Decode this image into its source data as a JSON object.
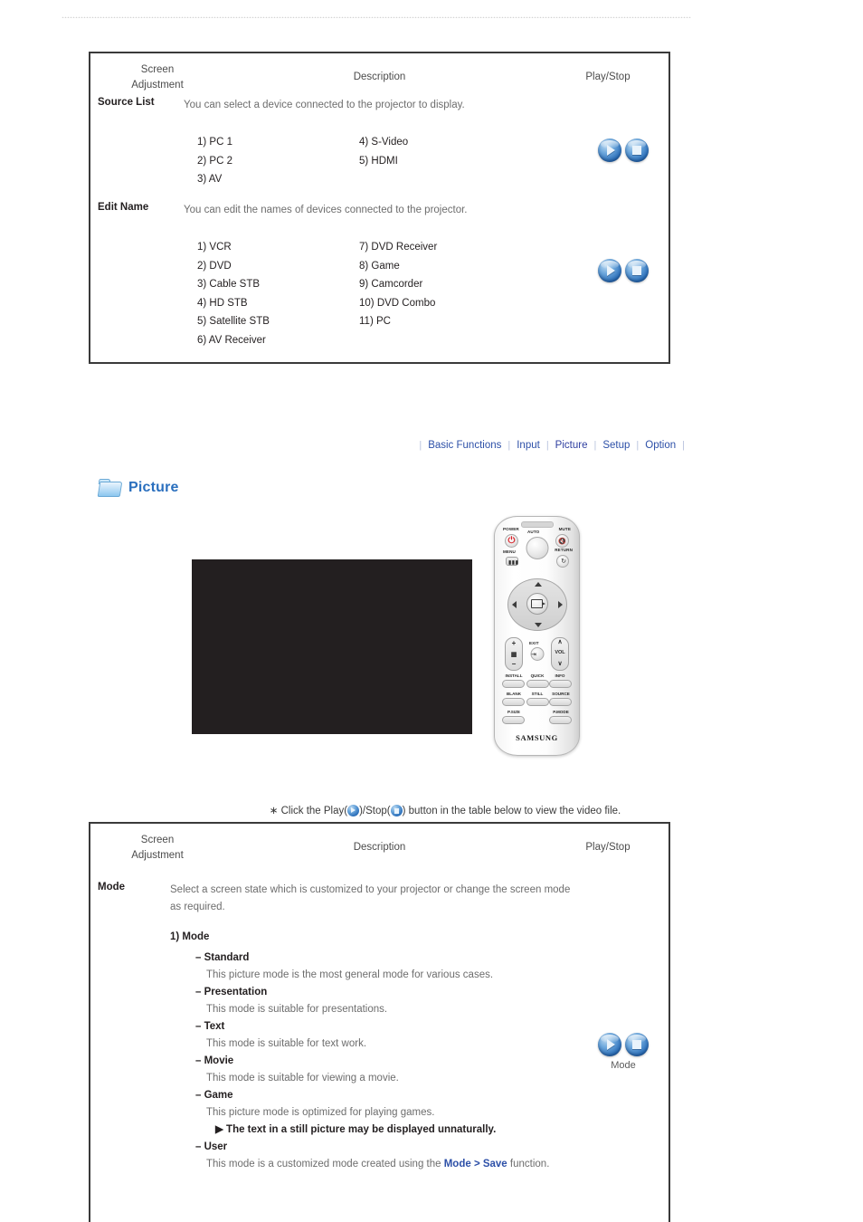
{
  "table_input": {
    "headers": {
      "col1_line1": "Screen",
      "col1_line2": "Adjustment",
      "col2": "Description",
      "col3": "Play/Stop"
    },
    "rows": [
      {
        "label": "Source List",
        "description": "You can select a device connected to the projector to display.",
        "left_items": [
          "1) PC 1",
          "2) PC 2",
          "3) AV"
        ],
        "right_items": [
          "4) S-Video",
          "5) HDMI"
        ]
      },
      {
        "label": "Edit Name",
        "description": "You can edit the names of devices connected to the projector.",
        "left_items": [
          "1) VCR",
          "2) DVD",
          "3) Cable STB",
          "4) HD STB",
          "5) Satellite STB",
          "6) AV Receiver"
        ],
        "right_items": [
          "7) DVD Receiver",
          "8) Game",
          "9) Camcorder",
          "10) DVD Combo",
          "11) PC"
        ]
      }
    ]
  },
  "nav": {
    "separator": "|",
    "items": [
      {
        "label": "Basic Functions",
        "current": false
      },
      {
        "label": "Input",
        "current": false
      },
      {
        "label": "Picture",
        "current": true
      },
      {
        "label": "Setup",
        "current": false
      },
      {
        "label": "Option",
        "current": false
      }
    ]
  },
  "section": {
    "icon": "folder-icon",
    "title": "Picture"
  },
  "remote": {
    "brand": "SAMSUNG",
    "labels": {
      "power": "POWER",
      "auto": "AUTO",
      "mute": "MUTE",
      "menu": "MENU",
      "return": "RETURN",
      "exit": "EXIT",
      "vol": "VOL",
      "install": "INSTALL",
      "quick": "QUICK",
      "info": "INFO",
      "blank": "BLANK",
      "still": "STILL",
      "source": "SOURCE",
      "psize": "P.SIZE",
      "pmode": "P.MODE"
    }
  },
  "video_note": {
    "prefix": "∗ Click the Play(",
    "middle": ")/Stop(",
    "suffix": ") button in the table below to view the video file."
  },
  "table_picture": {
    "headers": {
      "col1_line1": "Screen",
      "col1_line2": "Adjustment",
      "col2": "Description",
      "col3": "Play/Stop"
    },
    "row": {
      "label": "Mode",
      "description_line1": "Select a screen state which is customized to your projector or change the screen mode",
      "description_line2": "as required.",
      "list_title": "1) Mode",
      "modes": [
        {
          "name": "– Standard",
          "desc": "This picture mode is the most general mode for various cases."
        },
        {
          "name": "– Presentation",
          "desc": "This mode is suitable for presentations."
        },
        {
          "name": "– Text",
          "desc": "This mode is suitable for text work."
        },
        {
          "name": "– Movie",
          "desc": "This mode is suitable for viewing a movie."
        },
        {
          "name": "– Game",
          "desc": "This picture mode is optimized for playing games.",
          "note": "▶ The text in a still picture may be displayed unnaturally."
        },
        {
          "name": "– User",
          "desc_pre": "This mode is a customized mode created using the ",
          "desc_link": "Mode > Save",
          "desc_post": " function."
        }
      ],
      "playstop_caption": "Mode"
    }
  },
  "colors": {
    "nav_link": "#2d50a8",
    "section_title": "#2a6fbe",
    "body_text": "#6d6d6d",
    "heading_text": "#231f20",
    "button_blue": "#2d71bb",
    "video_bg": "#231f20"
  }
}
